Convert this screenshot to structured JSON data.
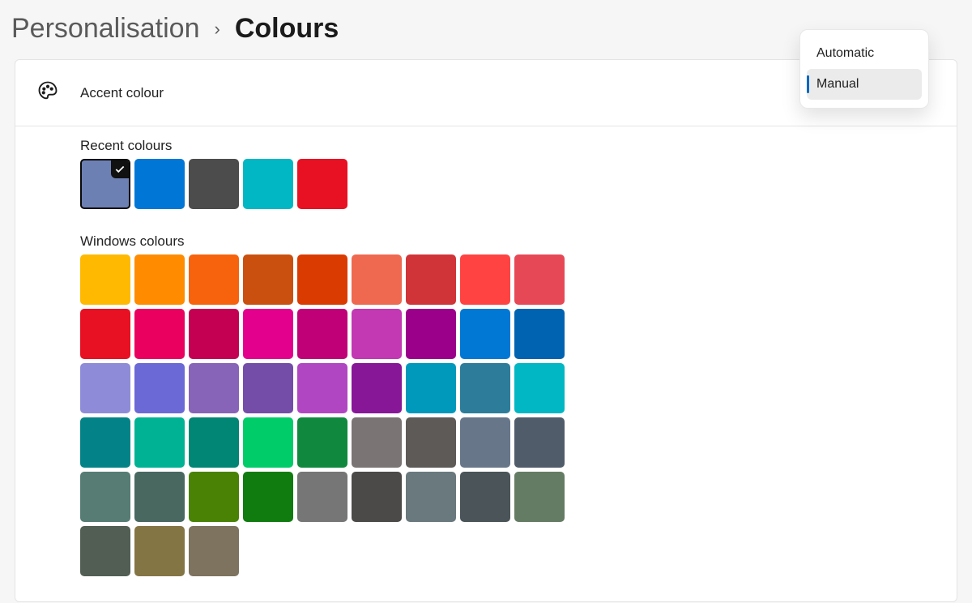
{
  "breadcrumb": {
    "parent": "Personalisation",
    "current": "Colours"
  },
  "accent": {
    "title": "Accent colour",
    "dropdown": {
      "options": [
        {
          "label": "Automatic",
          "selected": false
        },
        {
          "label": "Manual",
          "selected": true
        }
      ]
    }
  },
  "sections": {
    "recent_label": "Recent colours",
    "windows_label": "Windows colours"
  },
  "recent_colours": [
    {
      "hex": "#6d80b3",
      "selected": true
    },
    {
      "hex": "#0077d6",
      "selected": false
    },
    {
      "hex": "#4c4c4c",
      "selected": false
    },
    {
      "hex": "#00b7c3",
      "selected": false
    },
    {
      "hex": "#e81123",
      "selected": false
    }
  ],
  "windows_colours": [
    "#ffb900",
    "#ff8c00",
    "#f7630c",
    "#ca5010",
    "#da3b01",
    "#ef6950",
    "#d13438",
    "#ff4343",
    "#e74856",
    "#e81123",
    "#ea005e",
    "#c30052",
    "#e3008c",
    "#bf0077",
    "#c239b3",
    "#9a0089",
    "#0078d4",
    "#0063b1",
    "#8e8cd8",
    "#6b69d6",
    "#8764b8",
    "#744da9",
    "#b146c2",
    "#881798",
    "#0099bc",
    "#2d7d9a",
    "#00b7c3",
    "#038387",
    "#00b294",
    "#018574",
    "#00cc6a",
    "#10893e",
    "#7a7574",
    "#5d5a58",
    "#68768a",
    "#515c6b",
    "#567c73",
    "#486860",
    "#498205",
    "#107c10",
    "#767676",
    "#4c4a48",
    "#69797e",
    "#4a5459",
    "#647c64",
    "#525e54",
    "#847545",
    "#7e735f"
  ]
}
